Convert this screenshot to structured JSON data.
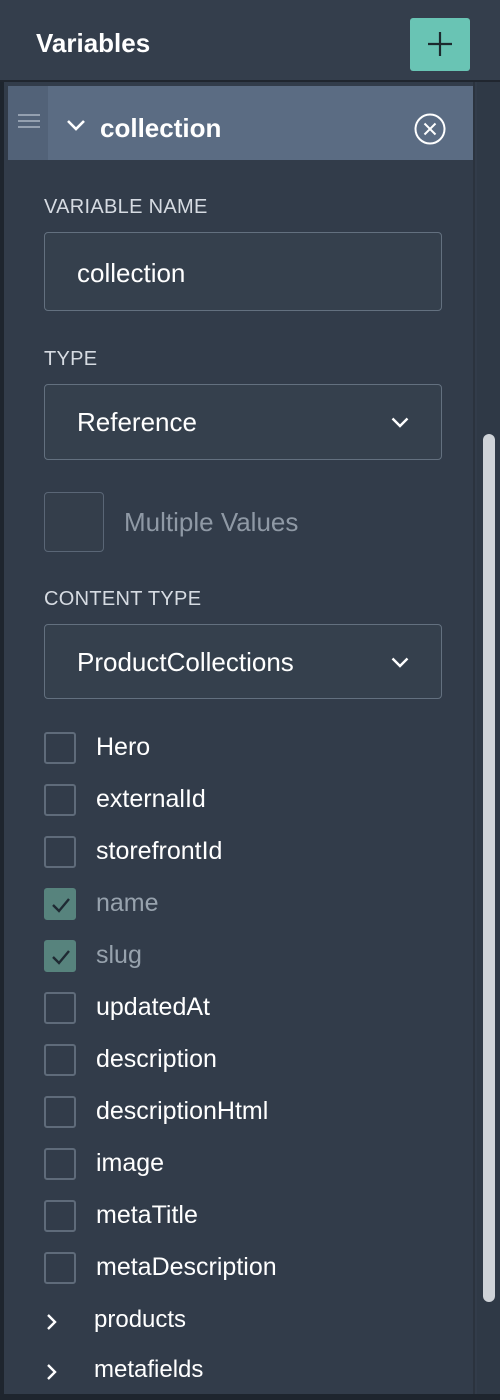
{
  "header": {
    "title": "Variables",
    "add_icon": "plus-icon",
    "add_color": "#69c4b4"
  },
  "variable": {
    "name": "collection",
    "fields": {
      "name_label": "VARIABLE NAME",
      "name_value": "collection",
      "type_label": "TYPE",
      "type_value": "Reference",
      "multiple_label": "Multiple Values",
      "multiple_checked": false,
      "content_type_label": "CONTENT TYPE",
      "content_type_value": "ProductCollections"
    }
  },
  "fields_list": [
    {
      "label": "Hero",
      "checked": false
    },
    {
      "label": "externalId",
      "checked": false
    },
    {
      "label": "storefrontId",
      "checked": false
    },
    {
      "label": "name",
      "checked": true
    },
    {
      "label": "slug",
      "checked": true
    },
    {
      "label": "updatedAt",
      "checked": false
    },
    {
      "label": "description",
      "checked": false
    },
    {
      "label": "descriptionHtml",
      "checked": false
    },
    {
      "label": "image",
      "checked": false
    },
    {
      "label": "metaTitle",
      "checked": false
    },
    {
      "label": "metaDescription",
      "checked": false
    }
  ],
  "relations": [
    {
      "label": "products"
    },
    {
      "label": "metafields"
    }
  ],
  "colors": {
    "background": "#323c4a",
    "row_highlight": "#5b6c83",
    "checked": "#57837d"
  }
}
